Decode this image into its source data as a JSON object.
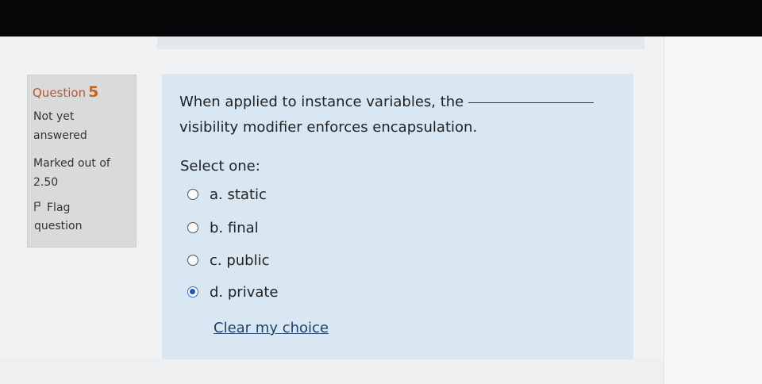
{
  "info": {
    "question_label": "Question",
    "question_number": "5",
    "state_line1": "Not yet",
    "state_line2": "answered",
    "grade_line1": "Marked out of",
    "grade_line2": "2.50",
    "flag_icon": "flag-icon",
    "flag_line1": "Flag",
    "flag_line2": "question"
  },
  "question": {
    "text_part1": "When applied to instance variables, the",
    "text_part2": "visibility modifier enforces encapsulation.",
    "prompt": "Select one:",
    "answers": [
      {
        "label": "a. static",
        "selected": false
      },
      {
        "label": "b. final",
        "selected": false
      },
      {
        "label": "c. public",
        "selected": false
      },
      {
        "label": "d. private",
        "selected": true
      }
    ],
    "clear_label": "Clear my choice"
  },
  "colors": {
    "info_bg": "#dadada",
    "question_bg": "#d9e7f2",
    "question_number": "#d06018",
    "selected_radio": "#1d55b8"
  }
}
